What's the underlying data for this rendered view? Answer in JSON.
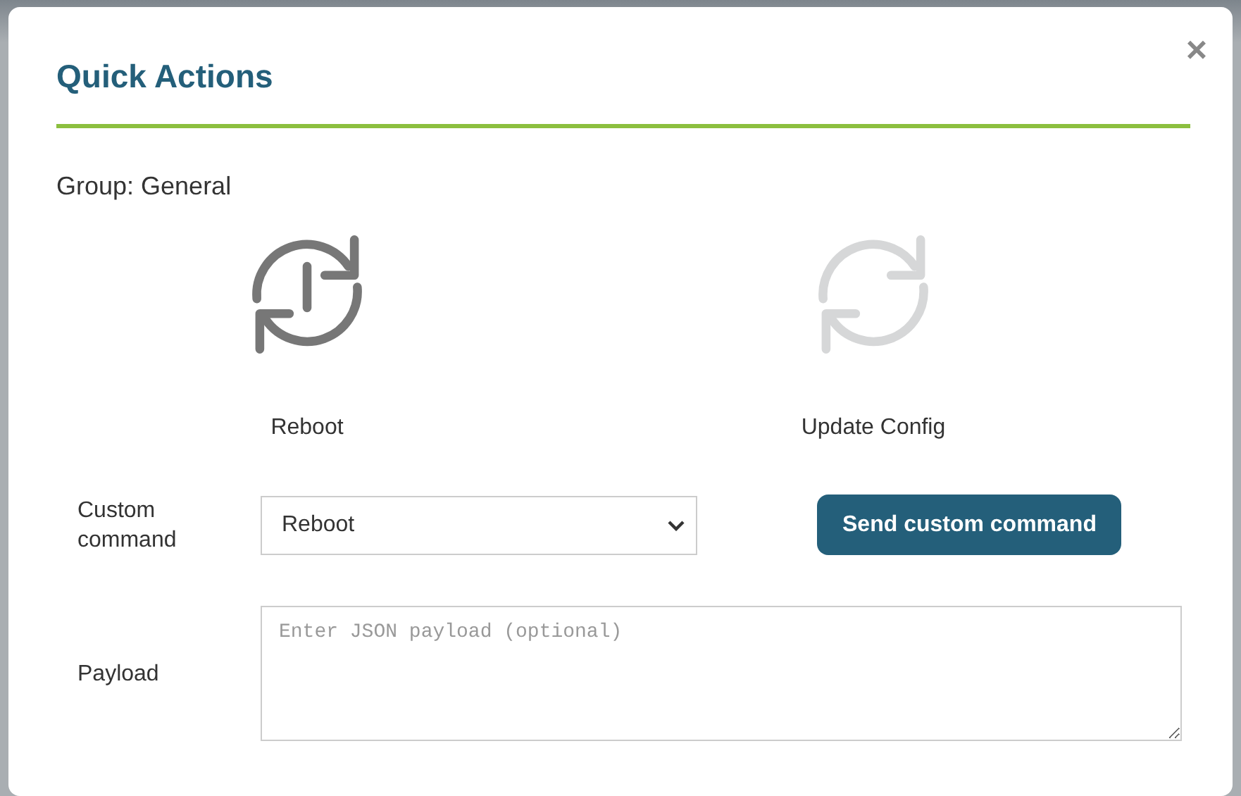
{
  "dialog": {
    "title": "Quick Actions",
    "close": "×"
  },
  "group_label": "Group: General",
  "actions": [
    {
      "kind": "reboot",
      "label": "Reboot",
      "disabled": false
    },
    {
      "kind": "sync",
      "label": "Update Config",
      "disabled": true
    }
  ],
  "custom_command": {
    "label": "Custom command",
    "value": "Reboot",
    "button": "Send custom command"
  },
  "payload": {
    "label": "Payload",
    "placeholder": "Enter JSON payload (optional)"
  }
}
